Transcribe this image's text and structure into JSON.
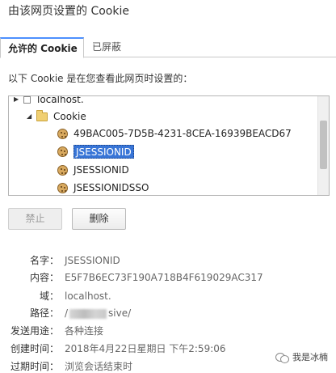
{
  "dialog": {
    "title": "由该网页设置的 Cookie",
    "close_glyph": "✕"
  },
  "tabs": [
    {
      "label": "允许的 Cookie",
      "active": true
    },
    {
      "label": "已屏蔽",
      "active": false
    }
  ],
  "intro_text": "以下 Cookie 是在您查看此网页时设置的：",
  "tree": {
    "host": "localhost.",
    "folder": "Cookie",
    "items": [
      {
        "label": "49BAC005-7D5B-4231-8CEA-16939BEACD67",
        "selected": false
      },
      {
        "label": "JSESSIONID",
        "selected": true
      },
      {
        "label": "JSESSIONID",
        "selected": false
      },
      {
        "label": "JSESSIONIDSSO",
        "selected": false
      }
    ],
    "icons": {
      "folder": "folder-icon",
      "cookie": "cookie-icon",
      "expand": "triangle-down-icon"
    }
  },
  "buttons": {
    "block": "禁止",
    "delete": "删除"
  },
  "details": {
    "name_label": "名字：",
    "name_value": "JSESSIONID",
    "content_label": "内容：",
    "content_value": "E5F7B6EC73F190A718B4F619029AC317",
    "domain_label": "域：",
    "domain_value": "localhost.",
    "path_label": "路径：",
    "path_prefix": "/",
    "path_suffix": "sive/",
    "sendfor_label": "发送用途：",
    "sendfor_value": "各种连接",
    "created_label": "创建时间：",
    "created_value": "2018年4月22日星期日 下午2:59:06",
    "expires_label": "过期时间：",
    "expires_value": "浏览会话结束时"
  },
  "watermark": {
    "text": "我是冰楠",
    "icon": "wechat-icon"
  },
  "colors": {
    "accent": "#4d90fe",
    "selection": "#3875d7"
  }
}
